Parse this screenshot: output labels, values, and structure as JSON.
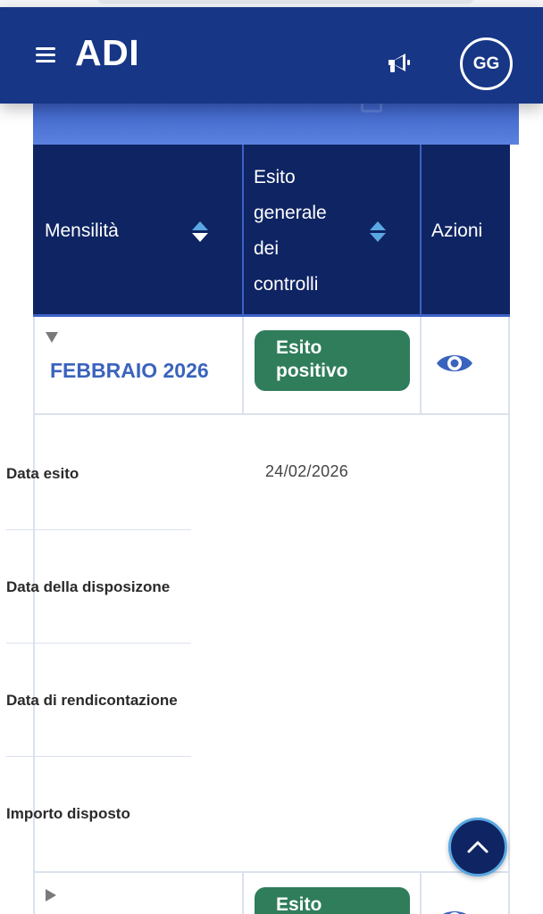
{
  "app": {
    "title": "ADI",
    "avatar_initials": "GG",
    "accent": "#173686",
    "header_dark": "#0f2462"
  },
  "toolbar": {
    "menu_icon": "hamburger-icon",
    "notify_icon": "megaphone-icon"
  },
  "table": {
    "columns": [
      {
        "label": "Mensilità",
        "sortable": true
      },
      {
        "label": "Esito\ngenerale\ndei\ncontrolli",
        "sortable": true
      },
      {
        "label": "Azioni",
        "sortable": false
      }
    ],
    "rows": [
      {
        "expanded": true,
        "month": "FEBBRAIO 2026",
        "status_line1": "Esito",
        "status_line2": "positivo",
        "status_color": "#2f7d5b",
        "action_icon": "eye-icon",
        "details": [
          {
            "label": "Data esito",
            "value": "24/02/2026"
          },
          {
            "label": "Data della disposizone",
            "value": ""
          },
          {
            "label": "Data di rendicontazione",
            "value": ""
          },
          {
            "label": "Importo disposto",
            "value": ""
          }
        ]
      },
      {
        "expanded": false,
        "month": "",
        "status_line1": "Esito",
        "status_line2": "",
        "action_icon": "eye-icon"
      }
    ]
  },
  "fab": {
    "icon": "chevron-up-icon"
  }
}
